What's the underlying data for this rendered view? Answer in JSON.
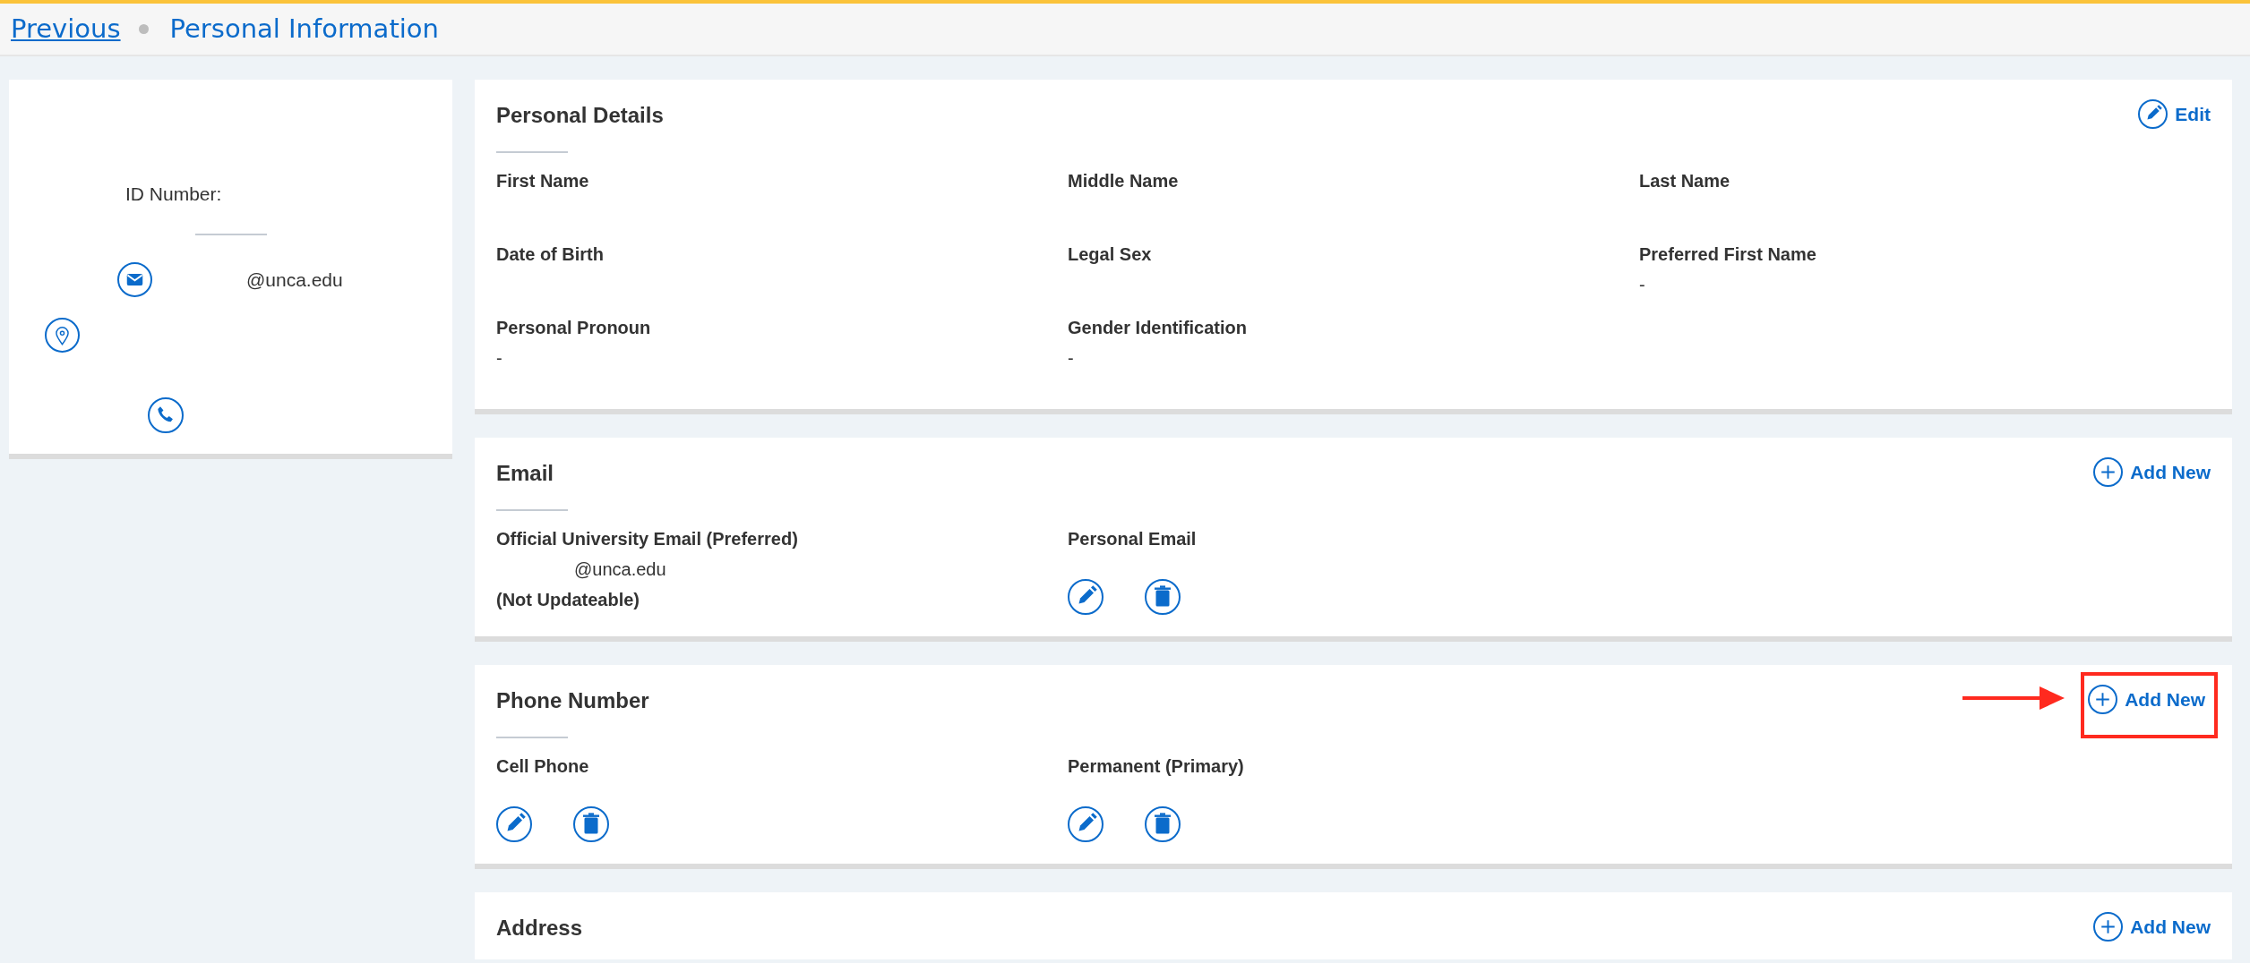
{
  "breadcrumb": {
    "previous": "Previous",
    "current": "Personal Information"
  },
  "profile": {
    "id_label": "ID Number:",
    "email": "@unca.edu"
  },
  "sections": [
    {
      "title": "Personal Details",
      "action": {
        "kind": "edit",
        "label": "Edit",
        "highlighted": false
      },
      "fields": [
        {
          "label": "First Name"
        },
        {
          "label": "Middle Name"
        },
        {
          "label": "Last Name"
        },
        {
          "label": "Date of Birth"
        },
        {
          "label": "Legal Sex"
        },
        {
          "label": "Preferred First Name",
          "value": "-"
        },
        {
          "label": "Personal Pronoun",
          "value": "-"
        },
        {
          "label": "Gender Identification",
          "value": "-"
        }
      ]
    },
    {
      "title": "Email",
      "action": {
        "kind": "add",
        "label": "Add New",
        "highlighted": false
      },
      "fields": [
        {
          "label": "Official University Email (Preferred)",
          "value": "@unca.edu",
          "note": "(Not Updateable)",
          "editable": false
        },
        {
          "label": "Personal Email",
          "editable": true
        }
      ]
    },
    {
      "title": "Phone Number",
      "action": {
        "kind": "add",
        "label": "Add New",
        "highlighted": true
      },
      "fields": [
        {
          "label": "Cell Phone",
          "editable": true
        },
        {
          "label": "Permanent (Primary)",
          "editable": true
        }
      ]
    },
    {
      "title": "Address",
      "action": {
        "kind": "add",
        "label": "Add New",
        "highlighted": false
      }
    }
  ]
}
